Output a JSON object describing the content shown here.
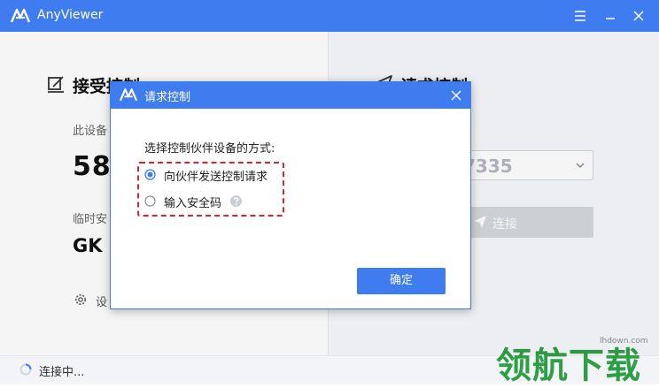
{
  "window": {
    "title": "AnyViewer"
  },
  "left": {
    "title": "接受控制",
    "device_id_label": "此设备",
    "device_id": "58",
    "temp_code_label": "临时安",
    "temp_code": "GK",
    "settings_label": "设"
  },
  "right": {
    "title": "请求控制",
    "partner_id": "7335",
    "connect_label": "连接"
  },
  "status": {
    "text": "连接中..."
  },
  "dialog": {
    "title": "请求控制",
    "prompt": "选择控制伙伴设备的方式:",
    "options": [
      {
        "label": "向伙伴发送控制请求",
        "selected": true
      },
      {
        "label": "输入安全码",
        "selected": false
      }
    ],
    "ok_label": "确定"
  },
  "watermark": {
    "text": "领航下载",
    "site": "lhdown.com"
  },
  "colors": {
    "accent": "#3e7cf0",
    "highlight": "#e0202a",
    "watermark": "#2f9f45"
  }
}
